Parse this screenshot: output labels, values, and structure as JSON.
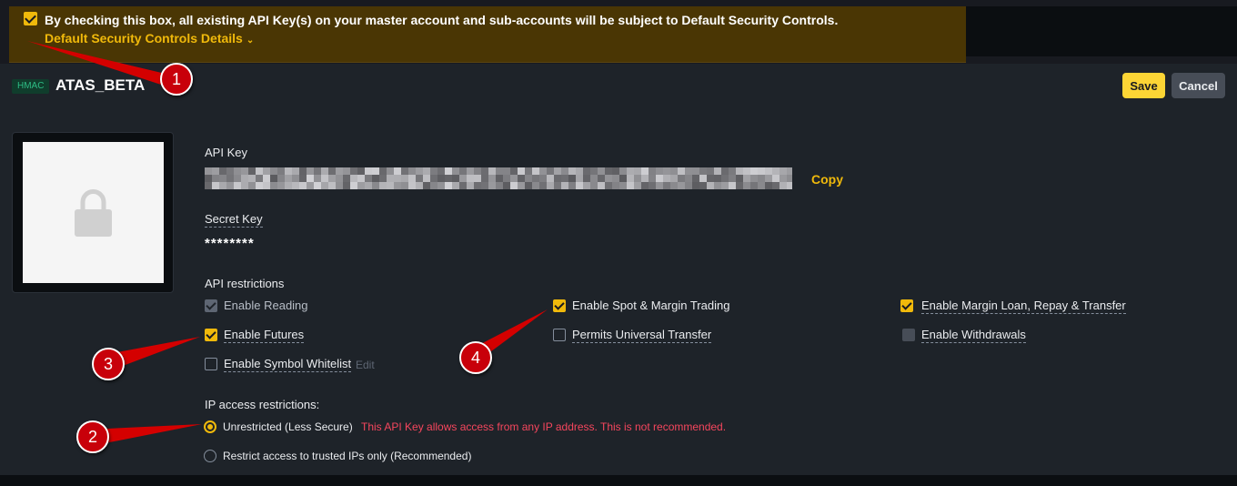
{
  "banner": {
    "checked": true,
    "message": "By checking this box, all existing API Key(s) on your master account and sub-accounts will be subject to Default Security Controls.",
    "link_label": "Default Security Controls Details"
  },
  "header": {
    "type_badge": "HMAC",
    "key_name": "ATAS_BETA",
    "save_label": "Save",
    "cancel_label": "Cancel"
  },
  "api_key": {
    "label": "API Key",
    "copy_label": "Copy"
  },
  "secret_key": {
    "label": "Secret Key",
    "value": "********"
  },
  "restrictions": {
    "title": "API restrictions",
    "options": [
      {
        "label": "Enable Reading",
        "state": "checked-disabled"
      },
      {
        "label": "Enable Spot & Margin Trading",
        "state": "checked"
      },
      {
        "label": "Enable Margin Loan, Repay & Transfer",
        "state": "checked"
      },
      {
        "label": "Enable Futures",
        "state": "checked"
      },
      {
        "label": "Permits Universal Transfer",
        "state": "unchecked"
      },
      {
        "label": "Enable Withdrawals",
        "state": "disabled"
      },
      {
        "label": "Enable Symbol Whitelist",
        "state": "unchecked"
      }
    ],
    "edit_label": "Edit"
  },
  "ip": {
    "title": "IP access restrictions:",
    "unrestricted_label": "Unrestricted (Less Secure)",
    "unrestricted_warning": "This API Key allows access from any IP address. This is not recommended.",
    "restricted_label": "Restrict access to trusted IPs only (Recommended)",
    "selected": "unrestricted"
  },
  "annotations": [
    "1",
    "2",
    "3",
    "4"
  ],
  "colors": {
    "accent": "#f0b90b",
    "warning": "#f6465d",
    "annotation": "#c8000a"
  }
}
